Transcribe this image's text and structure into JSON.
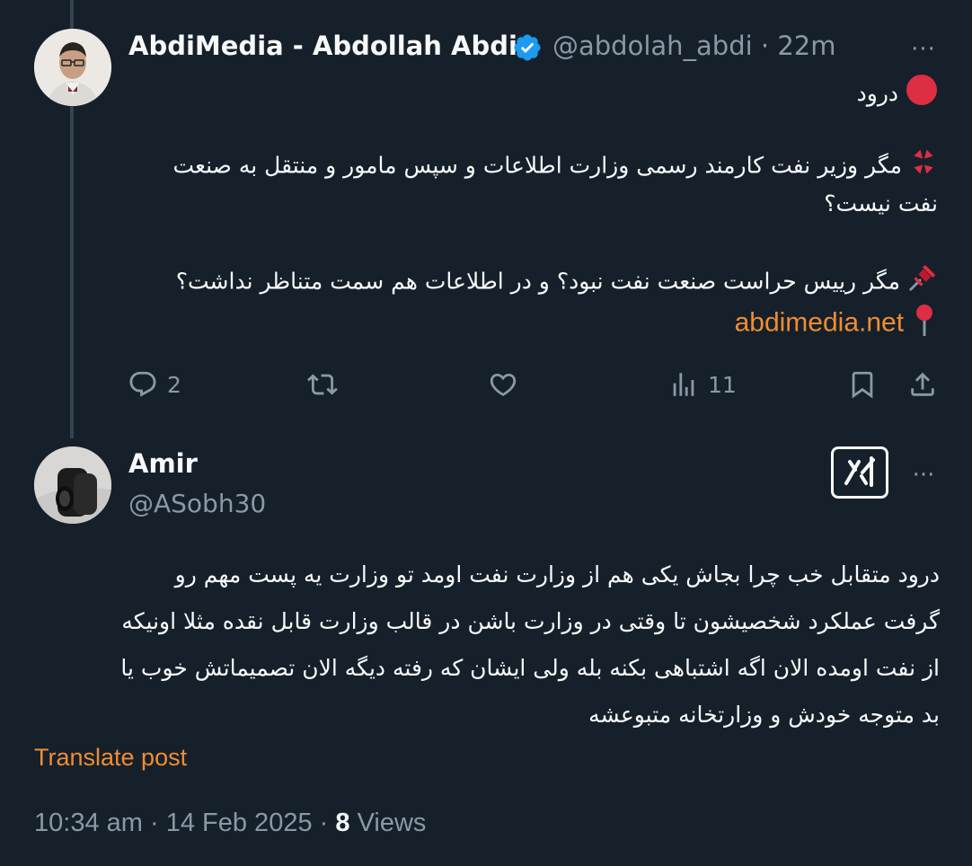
{
  "tweet1": {
    "display_name": "AbdiMedia - Abdollah Abdi",
    "handle": "@abdolah_abdi",
    "separator": "·",
    "time": "22m",
    "more_label": "···",
    "lines": {
      "greeting": "درود",
      "q1_line1": "مگر وزیر نفت کارمند رسمی وزارت اطلاعات و سپس مامور و منتقل به صنعت",
      "q1_line2": "نفت نیست؟",
      "q2": "مگر رییس حراست صنعت نفت نبود؟ و در اطلاعات هم سمت متناظر نداشت؟",
      "link": "abdimedia.net"
    },
    "emojis": {
      "greeting": "red-circle-icon",
      "q1": "anger-symbol-icon",
      "q2": "pushpin-icon",
      "link": "round-pushpin-icon"
    },
    "stats": {
      "replies": "2",
      "views": "11"
    }
  },
  "tweet2": {
    "display_name": "Amir",
    "handle": "@ASobh30",
    "more_label": "···",
    "lines": [
      "درود متقابل خب چرا بجاش یکی هم از وزارت نفت اومد تو وزارت یه پست مهم رو",
      "گرفت عملکرد شخصیشون تا وقتی در وزارت باشن در قالب وزارت قابل نقده مثلا اونیکه",
      "از نفت اومده الان اگه اشتباهی بکنه بله ولی ایشان که رفته دیگه الان تصمیماتش خوب یا",
      "بد متوجه خودش و وزارتخانه متبوعشه"
    ],
    "translate_label": "Translate post",
    "meta": {
      "time": "10:34 am",
      "sep1": "·",
      "date": "14 Feb 2025",
      "sep2": "·",
      "views_count": "8",
      "views_label": "Views"
    }
  },
  "colors": {
    "background": "#15202b",
    "text": "#f7f9f9",
    "muted": "#8b98a5",
    "link": "#f08c33",
    "verified": "#1d9bf0",
    "thread_line": "#38444d"
  }
}
